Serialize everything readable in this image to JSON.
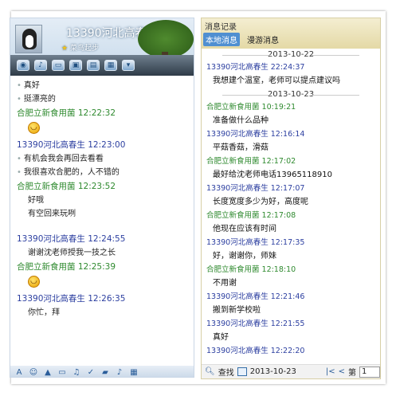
{
  "chat": {
    "title": "13390河北高春生",
    "subtitle": "菜鸟起步",
    "messages": [
      {
        "type": "text",
        "text": "真好"
      },
      {
        "type": "text",
        "text": "挺漂亮的"
      },
      {
        "type": "sender",
        "side": "green",
        "text": "合肥立新食用菌  12:22:32"
      },
      {
        "type": "emoji"
      },
      {
        "type": "sender",
        "side": "blue",
        "text": "13390河北高春生  12:23:00"
      },
      {
        "type": "text",
        "text": "有机会我会再回去看看"
      },
      {
        "type": "text",
        "text": "我很喜欢合肥的，人不错的"
      },
      {
        "type": "sender",
        "side": "green",
        "text": "合肥立新食用菌  12:23:52"
      },
      {
        "type": "plain",
        "text": "好哦"
      },
      {
        "type": "plain",
        "text": "有空回来玩咧"
      },
      {
        "type": "gap"
      },
      {
        "type": "sender",
        "side": "blue",
        "text": "13390河北高春生  12:24:55"
      },
      {
        "type": "plain",
        "text": "谢谢沈老师授我一技之长"
      },
      {
        "type": "sender",
        "side": "green",
        "text": "合肥立新食用菌  12:25:39"
      },
      {
        "type": "emoji"
      },
      {
        "type": "sender",
        "side": "blue",
        "text": "13390河北高春生  12:26:35"
      },
      {
        "type": "plain",
        "text": "你忙，拜"
      }
    ]
  },
  "history": {
    "title": "消息记录",
    "tabs": [
      "本地消息",
      "漫游消息"
    ],
    "entries": [
      {
        "type": "date",
        "text": "2013-10-22"
      },
      {
        "type": "sender",
        "side": "blue",
        "text": "13390河北高春生 22:24:37"
      },
      {
        "type": "text",
        "text": "我想建个温室，老师可以提点建议吗"
      },
      {
        "type": "date",
        "text": "2013-10-23"
      },
      {
        "type": "sender",
        "side": "green",
        "text": "合肥立新食用菌 10:19:21"
      },
      {
        "type": "text",
        "text": "准备做什么品种"
      },
      {
        "type": "sender",
        "side": "blue",
        "text": "13390河北高春生 12:16:14"
      },
      {
        "type": "text",
        "text": "平菇香菇，滑菇"
      },
      {
        "type": "sender",
        "side": "green",
        "text": "合肥立新食用菌 12:17:02"
      },
      {
        "type": "text",
        "text": "最好给沈老师电话13965118910"
      },
      {
        "type": "sender",
        "side": "blue",
        "text": "13390河北高春生 12:17:07"
      },
      {
        "type": "text",
        "text": "长度宽度多少为好，高度呢"
      },
      {
        "type": "sender",
        "side": "green",
        "text": "合肥立新食用菌 12:17:08"
      },
      {
        "type": "text",
        "text": "他现在应该有时间"
      },
      {
        "type": "sender",
        "side": "blue",
        "text": "13390河北高春生 12:17:35"
      },
      {
        "type": "text",
        "text": "好，谢谢你，师妹"
      },
      {
        "type": "sender",
        "side": "green",
        "text": "合肥立新食用菌 12:18:10"
      },
      {
        "type": "text",
        "text": "不用谢"
      },
      {
        "type": "sender",
        "side": "blue",
        "text": "13390河北高春生 12:21:46"
      },
      {
        "type": "text",
        "text": "搬到新学校啦"
      },
      {
        "type": "sender",
        "side": "blue",
        "text": "13390河北高春生 12:21:55"
      },
      {
        "type": "text",
        "text": "真好"
      },
      {
        "type": "sender",
        "side": "blue",
        "text": "13390河北高春生 12:22:20"
      }
    ],
    "footer": {
      "search_label": "查找",
      "date_value": "2013-10-23",
      "page_label": "第",
      "page_value": "1"
    }
  }
}
